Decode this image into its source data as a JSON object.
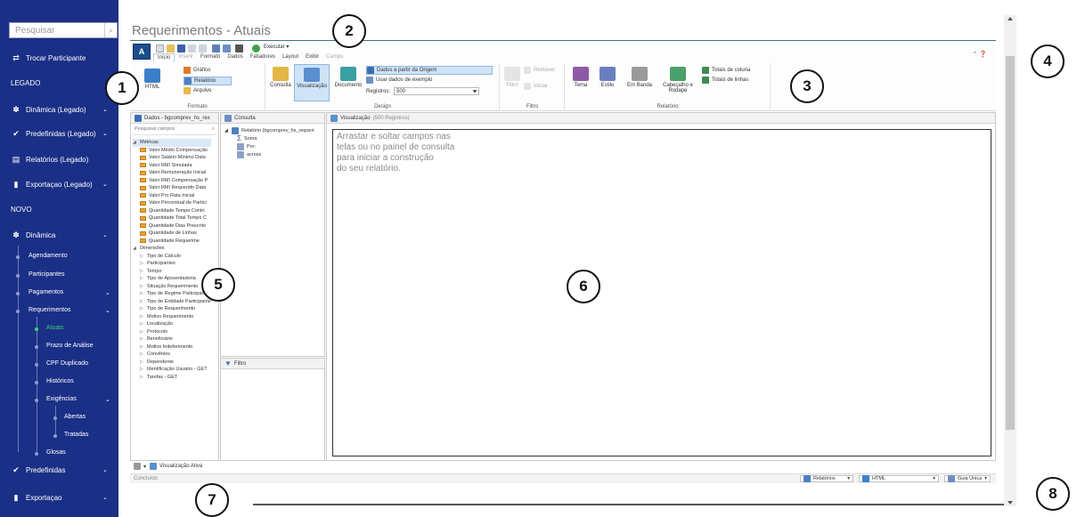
{
  "sidebar": {
    "search_placeholder": "Pesquisar",
    "items": [
      {
        "label": "Trocar Participante",
        "icon": "swap-icon",
        "chev": ""
      },
      {
        "label": "Dinâmica (Legado)",
        "icon": "network-icon",
        "chev": "⌄"
      },
      {
        "label": "Predefinidas (Legado)",
        "icon": "check-icon",
        "chev": "⌄"
      },
      {
        "label": "Relatórios (Legado)",
        "icon": "report-icon",
        "chev": ""
      },
      {
        "label": "Exportaçao (Legado)",
        "icon": "document-icon",
        "chev": "⌄"
      },
      {
        "label": "Dinâmica",
        "icon": "network-icon",
        "chev": "⌄"
      },
      {
        "label": "Predefinidas",
        "icon": "check-icon",
        "chev": "⌄"
      },
      {
        "label": "Exportaçao",
        "icon": "document-icon",
        "chev": "⌄"
      }
    ],
    "sections": [
      "LEGADO",
      "NOVO"
    ],
    "sub_items": [
      {
        "label": "Agendamento",
        "chev": ""
      },
      {
        "label": "Participantes",
        "chev": ""
      },
      {
        "label": "Pagamentos",
        "chev": "⌄"
      },
      {
        "label": "Requerimentos",
        "chev": "⌄"
      },
      {
        "label": "Atuais",
        "chev": ""
      },
      {
        "label": "Prazo de Análise",
        "chev": ""
      },
      {
        "label": "CPF Duplicado",
        "chev": ""
      },
      {
        "label": "Históricos",
        "chev": ""
      },
      {
        "label": "Exigências",
        "chev": "⌄"
      },
      {
        "label": "Abertas",
        "chev": ""
      },
      {
        "label": "Tratadas",
        "chev": ""
      },
      {
        "label": "Glosas",
        "chev": ""
      }
    ]
  },
  "page": {
    "title": "Requerimentos - Atuais"
  },
  "ribbon": {
    "executar": "Executar ▾",
    "tabs": [
      "Início",
      "Inserir",
      "Formato",
      "Dados",
      "Fatiadores",
      "Layout",
      "Exibir",
      "Campo"
    ],
    "groups": {
      "formato": {
        "label": "Formato",
        "html": "HTML",
        "grafico": "Gráfico",
        "relatorio": "Relatório",
        "arquivo": "Arquivo"
      },
      "design": {
        "label": "Design",
        "consulta": "Consulta",
        "visualizacao": "Visualização",
        "documento": "Documento",
        "dados_origem": "Dados a partir da Origem",
        "usar_exemplo": "Usar dados de exemplo",
        "registros_label": "Registros:",
        "registros_value": "500"
      },
      "filtro": {
        "label": "Filtro",
        "filtro": "Filtro",
        "remover": "Remover",
        "iniciar": "Iniciar"
      },
      "relatorio": {
        "label": "Relatório",
        "tema": "Tema",
        "estilo": "Estilo",
        "em_banda": "Em Banda",
        "cabecalho": "Cabeçalho e Rodapé",
        "totais_coluna": "Totais de coluna",
        "totais_linhas": "Totais de linhas"
      }
    }
  },
  "panels": {
    "dados": {
      "title": "Dados - bgcomprev_hs_rex",
      "search": "Pesquisar campos",
      "metricas_label": "Métricas",
      "metricas": [
        "Valor Médio Compensação",
        "Valor Salário Mínimo Data",
        "Valor RMI Simulada",
        "Valor Remuneração Inicial",
        "Valor RMI Compensação P",
        "Valor RMI Requerido Data",
        "Valor Pro Rata Inicial",
        "Valor Percentual de Partici",
        "Quantidade Tempo Contri",
        "Quantidade Total Tempo C",
        "Quantidade Dias Prescrito",
        "Quantidade de Linhas",
        "Quantidade Requerime"
      ],
      "dimensoes_label": "Dimensões",
      "dimensoes": [
        "Tipo de Cálculo",
        "Participantes",
        "Tempo",
        "Tipo de Aposentadoria",
        "Situação Requerimento",
        "Tipo de Regime Participante",
        "Tipo de Entidade Participante",
        "Tipo de Requerimento",
        "Motivo Requerimento",
        "Localização",
        "Protocolo",
        "Beneficiário",
        "Motivo Indeferimento",
        "Convênios",
        "Dependente",
        "Identificação Usuário - GET",
        "Tarefas - GET"
      ]
    },
    "consulta": {
      "title": "Consulta",
      "root": "Relatório (bgcomprev_hs_requeri",
      "items": [
        "Soma",
        "Por:",
        "across"
      ]
    },
    "filtro": {
      "title": "Filtro"
    },
    "visualizacao": {
      "title": "Visualização",
      "registros": "(500 Registros)",
      "hint": [
        "Arrastar e soltar campos nas",
        "telas ou no painel de consulta",
        "para iniciar a construção",
        "do seu relatório."
      ]
    }
  },
  "bottom": {
    "visualizacao_ativa": "Visualização Ativa"
  },
  "status": {
    "text": "Concluído",
    "relatorios": "Relatórios",
    "html": "HTML",
    "guia_unica": "Guia Única"
  },
  "callouts": [
    "1",
    "2",
    "3",
    "4",
    "5",
    "6",
    "7",
    "8"
  ]
}
